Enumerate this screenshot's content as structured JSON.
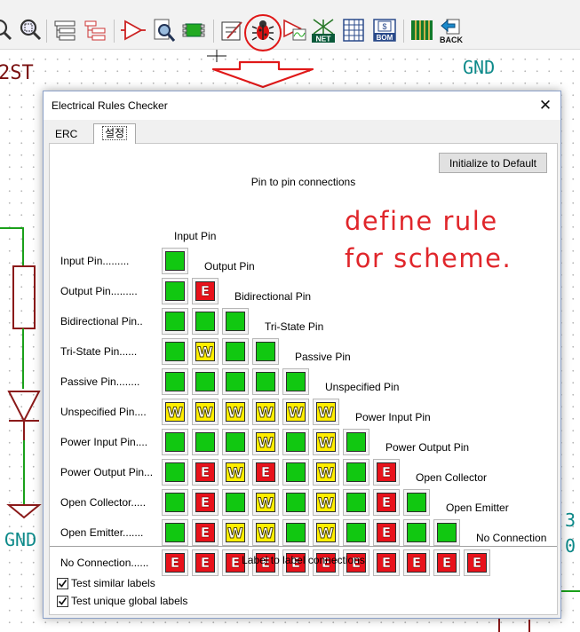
{
  "toolbar": {
    "icons": [
      "zoom-out-icon",
      "zoom-area-icon",
      "hierarchy-navigator-icon",
      "leave-sheet-icon",
      "annotate-icon",
      "find-icon",
      "footprint-assign-icon",
      "edit-fields-icon",
      "erc-bug-icon",
      "spice-simulator-icon",
      "netlist-icon",
      "bus-grid-icon",
      "bom-icon",
      "pcb-icon",
      "back-icon"
    ],
    "labels": {
      "netlist": "NET",
      "bom": "BOM",
      "bom_symbol": "$",
      "back": "BACK"
    }
  },
  "schematic": {
    "left_text": "2ST",
    "gnd_top": "GND",
    "gnd_bottom": "GND",
    "right_partial_1": "3",
    "right_partial_2": "0"
  },
  "dialog": {
    "title": "Electrical Rules Checker",
    "close_glyph": "✕",
    "tabs": [
      "ERC",
      "설정"
    ],
    "active_tab": 1,
    "reset_button": "Initialize to Default",
    "pin_section_title": "Pin to pin connections",
    "annotation_line1": "define rule",
    "annotation_line2": "for scheme.",
    "pin_types": [
      {
        "row_label": "Input Pin.........",
        "column_label": "Input Pin"
      },
      {
        "row_label": "Output Pin.........",
        "column_label": "Output Pin"
      },
      {
        "row_label": "Bidirectional Pin..",
        "column_label": "Bidirectional Pin"
      },
      {
        "row_label": "Tri-State Pin......",
        "column_label": "Tri-State Pin"
      },
      {
        "row_label": "Passive Pin........",
        "column_label": "Passive Pin"
      },
      {
        "row_label": "Unspecified Pin....",
        "column_label": "Unspecified Pin"
      },
      {
        "row_label": "Power Input Pin....",
        "column_label": "Power Input Pin"
      },
      {
        "row_label": "Power Output Pin...",
        "column_label": "Power Output Pin"
      },
      {
        "row_label": "Open Collector.....",
        "column_label": "Open Collector"
      },
      {
        "row_label": "Open Emitter.......",
        "column_label": "Open Emitter"
      },
      {
        "row_label": "No Connection......",
        "column_label": "No Connection"
      }
    ],
    "matrix": [
      [
        "ok"
      ],
      [
        "ok",
        "E"
      ],
      [
        "ok",
        "ok",
        "ok"
      ],
      [
        "ok",
        "W",
        "ok",
        "ok"
      ],
      [
        "ok",
        "ok",
        "ok",
        "ok",
        "ok"
      ],
      [
        "W",
        "W",
        "W",
        "W",
        "W",
        "W"
      ],
      [
        "ok",
        "ok",
        "ok",
        "W",
        "ok",
        "W",
        "ok"
      ],
      [
        "ok",
        "E",
        "W",
        "E",
        "ok",
        "W",
        "ok",
        "E"
      ],
      [
        "ok",
        "E",
        "ok",
        "W",
        "ok",
        "W",
        "ok",
        "E",
        "ok"
      ],
      [
        "ok",
        "E",
        "W",
        "W",
        "ok",
        "W",
        "ok",
        "E",
        "ok",
        "ok"
      ],
      [
        "E",
        "E",
        "E",
        "E",
        "E",
        "E",
        "E",
        "E",
        "E",
        "E",
        "E"
      ]
    ],
    "label_section_title": "Label to label connections",
    "checkboxes": [
      {
        "label": "Test similar labels",
        "checked": true
      },
      {
        "label": "Test unique global labels",
        "checked": true
      }
    ]
  },
  "colors": {
    "ok": "#11c811",
    "warning": "#ffee00",
    "error": "#e8121b",
    "annotation": "#e0262b",
    "schematic_net": "#0d8a8a",
    "schematic_wire": "#1aa01a",
    "schematic_component": "#8b1a1a"
  }
}
